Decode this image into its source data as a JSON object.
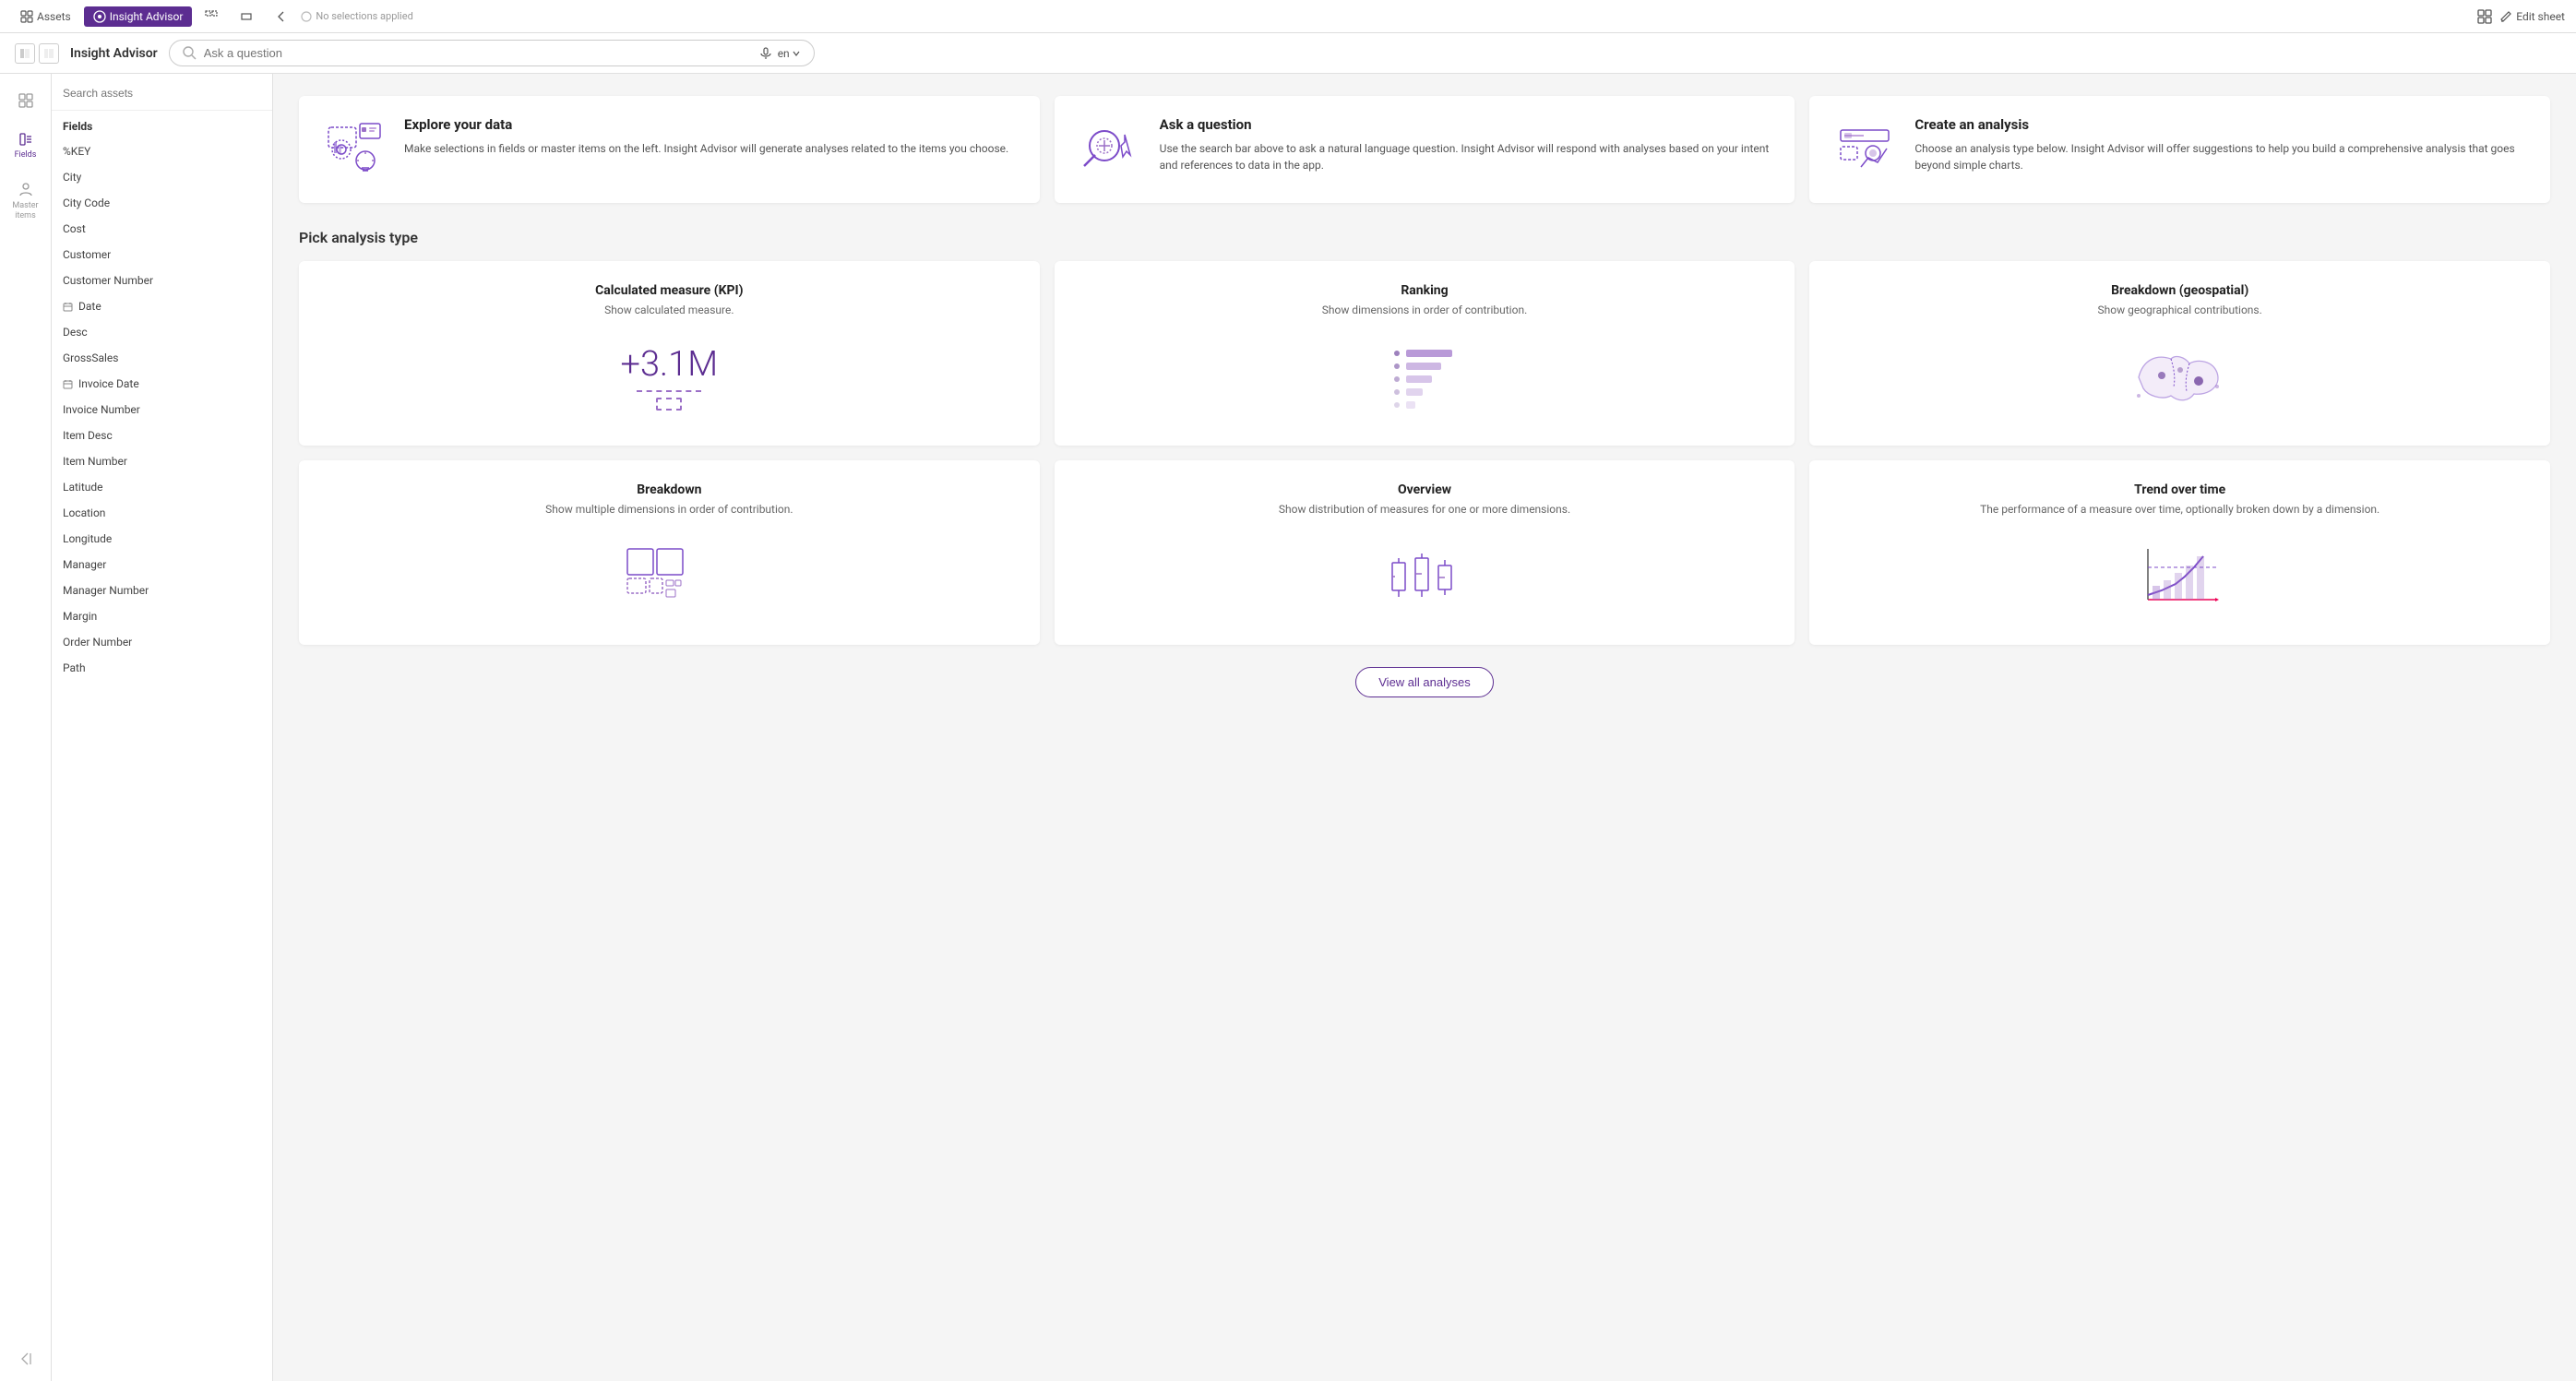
{
  "topNav": {
    "assets_label": "Assets",
    "insight_label": "Insight Advisor",
    "no_selections": "No selections applied",
    "edit_sheet": "Edit sheet"
  },
  "secondBar": {
    "app_title": "Insight Advisor",
    "search_placeholder": "Ask a question",
    "lang": "en"
  },
  "iconPanel": {
    "items": [
      {
        "id": "grid",
        "label": ""
      },
      {
        "id": "fields",
        "label": "Fields",
        "active": true
      },
      {
        "id": "master",
        "label": "Master items"
      }
    ]
  },
  "sidebar": {
    "search_placeholder": "Search assets",
    "section_title": "Fields",
    "items": [
      {
        "id": "key",
        "label": "%KEY",
        "icon": ""
      },
      {
        "id": "city",
        "label": "City",
        "icon": ""
      },
      {
        "id": "city-code",
        "label": "City Code",
        "icon": ""
      },
      {
        "id": "cost",
        "label": "Cost",
        "icon": ""
      },
      {
        "id": "customer",
        "label": "Customer",
        "icon": ""
      },
      {
        "id": "customer-number",
        "label": "Customer Number",
        "icon": ""
      },
      {
        "id": "date",
        "label": "Date",
        "icon": "cal"
      },
      {
        "id": "desc",
        "label": "Desc",
        "icon": ""
      },
      {
        "id": "gross-sales",
        "label": "GrossSales",
        "icon": ""
      },
      {
        "id": "invoice-date",
        "label": "Invoice Date",
        "icon": "cal"
      },
      {
        "id": "invoice-number",
        "label": "Invoice Number",
        "icon": ""
      },
      {
        "id": "item-desc",
        "label": "Item Desc",
        "icon": ""
      },
      {
        "id": "item-number",
        "label": "Item Number",
        "icon": ""
      },
      {
        "id": "latitude",
        "label": "Latitude",
        "icon": ""
      },
      {
        "id": "location",
        "label": "Location",
        "icon": ""
      },
      {
        "id": "longitude",
        "label": "Longitude",
        "icon": ""
      },
      {
        "id": "manager",
        "label": "Manager",
        "icon": ""
      },
      {
        "id": "manager-number",
        "label": "Manager Number",
        "icon": ""
      },
      {
        "id": "margin",
        "label": "Margin",
        "icon": ""
      },
      {
        "id": "order-number",
        "label": "Order Number",
        "icon": ""
      },
      {
        "id": "path",
        "label": "Path",
        "icon": ""
      }
    ]
  },
  "infoCards": [
    {
      "id": "explore",
      "title": "Explore your data",
      "description": "Make selections in fields or master items on the left. Insight Advisor will generate analyses related to the items you choose."
    },
    {
      "id": "ask",
      "title": "Ask a question",
      "description": "Use the search bar above to ask a natural language question. Insight Advisor will respond with analyses based on your intent and references to data in the app."
    },
    {
      "id": "create",
      "title": "Create an analysis",
      "description": "Choose an analysis type below. Insight Advisor will offer suggestions to help you build a comprehensive analysis that goes beyond simple charts."
    }
  ],
  "pickSection": {
    "title": "Pick analysis type"
  },
  "analysisTypes": [
    {
      "id": "kpi",
      "title": "Calculated measure (KPI)",
      "description": "Show calculated measure.",
      "visual": "kpi"
    },
    {
      "id": "ranking",
      "title": "Ranking",
      "description": "Show dimensions in order of contribution.",
      "visual": "ranking"
    },
    {
      "id": "geospatial",
      "title": "Breakdown (geospatial)",
      "description": "Show geographical contributions.",
      "visual": "geo"
    },
    {
      "id": "breakdown",
      "title": "Breakdown",
      "description": "Show multiple dimensions in order of contribution.",
      "visual": "breakdown"
    },
    {
      "id": "overview",
      "title": "Overview",
      "description": "Show distribution of measures for one or more dimensions.",
      "visual": "overview"
    },
    {
      "id": "trend",
      "title": "Trend over time",
      "description": "The performance of a measure over time, optionally broken down by a dimension.",
      "visual": "trend"
    }
  ],
  "viewAllBtn": "View all analyses",
  "kpiValue": "+3.1M",
  "colors": {
    "primary": "#5c2d91",
    "light_purple": "#9b6fc7",
    "border": "#e0e0e0"
  }
}
